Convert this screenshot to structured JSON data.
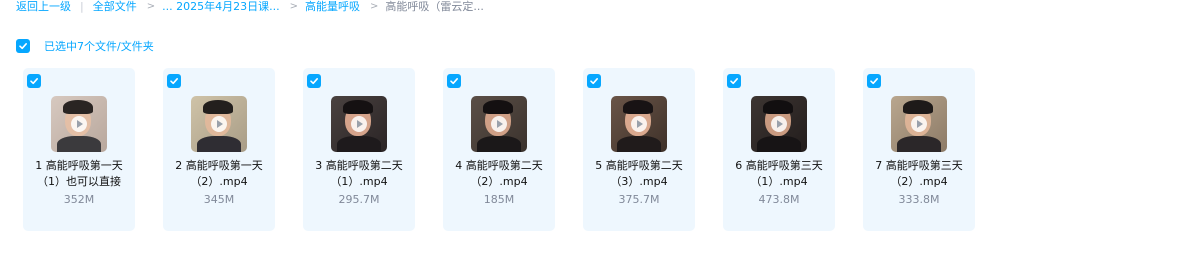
{
  "breadcrumb": {
    "back": "返回上一级",
    "all_files": "全部文件",
    "ellipsis_folder": "... 2025年4月23日课...",
    "folder": "高能量呼吸",
    "current": "高能呼吸（雷云定..."
  },
  "selection": {
    "label": "已选中7个文件/文件夹"
  },
  "colors": {
    "accent": "#06a7ff",
    "card_bg": "#eef7fe",
    "muted_text": "#818999"
  },
  "files": [
    {
      "name_line1": "1 高能呼吸第一天",
      "name_line2": "（1）也可以直接",
      "size": "352M",
      "icon": "video-thumbnail",
      "checked": true
    },
    {
      "name_line1": "2 高能呼吸第一天",
      "name_line2": "（2）.mp4",
      "size": "345M",
      "icon": "video-thumbnail",
      "checked": true
    },
    {
      "name_line1": "3 高能呼吸第二天",
      "name_line2": "（1）.mp4",
      "size": "295.7M",
      "icon": "video-thumbnail",
      "checked": true
    },
    {
      "name_line1": "4 高能呼吸第二天",
      "name_line2": "（2）.mp4",
      "size": "185M",
      "icon": "video-thumbnail",
      "checked": true
    },
    {
      "name_line1": "5 高能呼吸第二天",
      "name_line2": "（3）.mp4",
      "size": "375.7M",
      "icon": "video-thumbnail",
      "checked": true
    },
    {
      "name_line1": "6 高能呼吸第三天",
      "name_line2": "（1）.mp4",
      "size": "473.8M",
      "icon": "video-thumbnail",
      "checked": true
    },
    {
      "name_line1": "7 高能呼吸第三天",
      "name_line2": "（2）.mp4",
      "size": "333.8M",
      "icon": "video-thumbnail",
      "checked": true
    }
  ]
}
